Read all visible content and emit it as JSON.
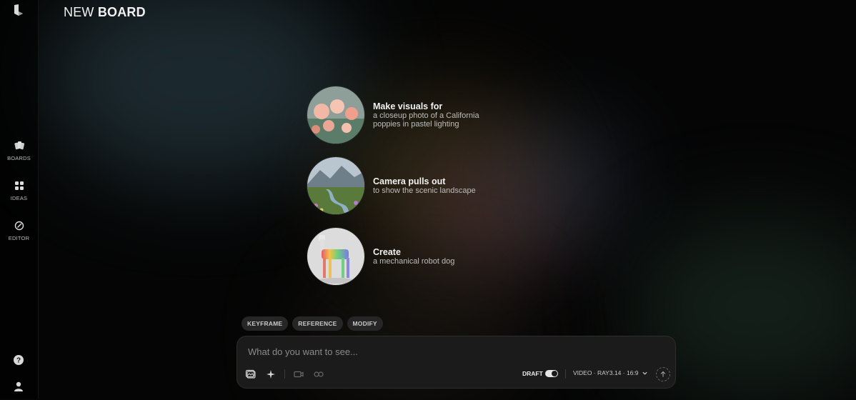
{
  "header": {
    "title_light": "NEW",
    "title_bold": "BOARD"
  },
  "sidebar": {
    "items": [
      {
        "label": "BOARDS",
        "icon": "boards-icon"
      },
      {
        "label": "IDEAS",
        "icon": "ideas-icon"
      },
      {
        "label": "EDITOR",
        "icon": "editor-icon"
      }
    ],
    "help_icon": "help-icon",
    "user_icon": "user-icon"
  },
  "suggestions": [
    {
      "title": "Make visuals for",
      "subtitle": "a closeup photo of a California poppies in pastel lighting",
      "thumb": "poppies"
    },
    {
      "title": "Camera pulls out",
      "subtitle": "to show the scenic landscape",
      "thumb": "landscape"
    },
    {
      "title": "Create",
      "subtitle": "a mechanical robot dog",
      "thumb": "robot-dog"
    }
  ],
  "chips": [
    "KEYFRAME",
    "REFERENCE",
    "MODIFY"
  ],
  "prompt": {
    "placeholder": "What do you want to see...",
    "draft_label": "DRAFT",
    "draft_on": true,
    "model_label": "VIDEO · RAY3.14 · 16:9"
  }
}
